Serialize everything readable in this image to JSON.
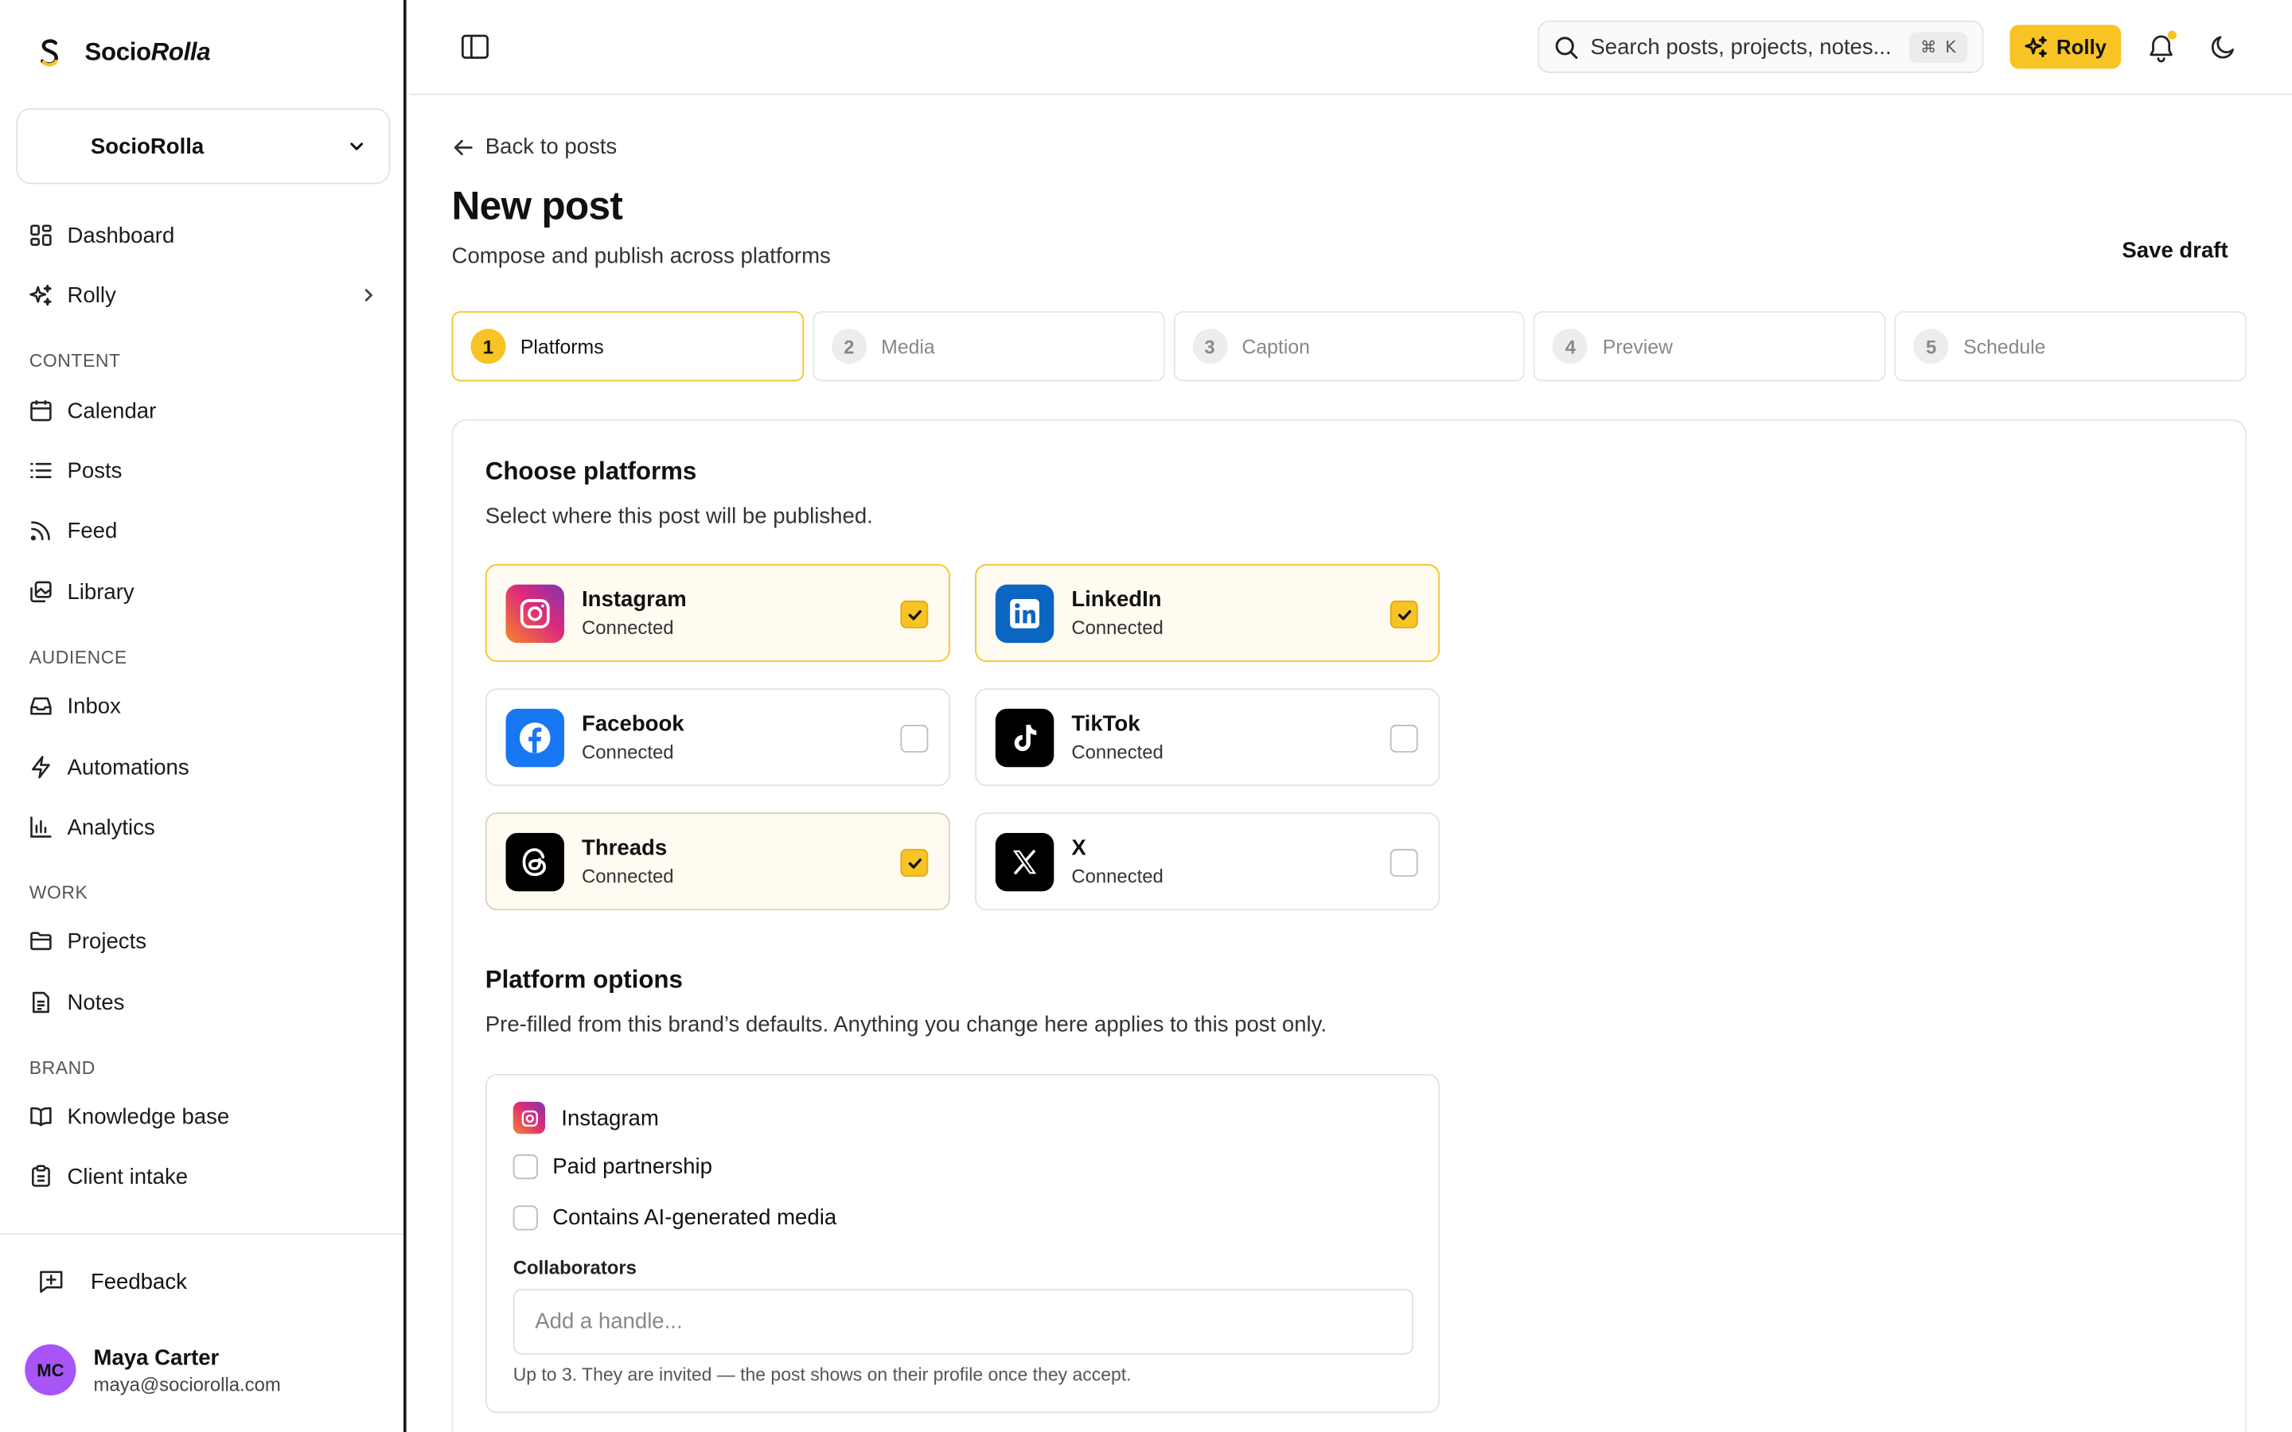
{
  "app": {
    "brand_prefix": "Socio",
    "brand_suffix": "Rolla"
  },
  "workspace": {
    "name": "SocioRolla"
  },
  "sidebar": {
    "top_items": [
      {
        "label": "Dashboard"
      },
      {
        "label": "Rolly"
      }
    ],
    "sections": [
      {
        "title": "CONTENT",
        "items": [
          {
            "label": "Calendar"
          },
          {
            "label": "Posts"
          },
          {
            "label": "Feed"
          },
          {
            "label": "Library"
          }
        ]
      },
      {
        "title": "AUDIENCE",
        "items": [
          {
            "label": "Inbox"
          },
          {
            "label": "Automations"
          },
          {
            "label": "Analytics"
          }
        ]
      },
      {
        "title": "WORK",
        "items": [
          {
            "label": "Projects"
          },
          {
            "label": "Notes"
          }
        ]
      },
      {
        "title": "BRAND",
        "items": [
          {
            "label": "Knowledge base"
          },
          {
            "label": "Client intake"
          }
        ]
      }
    ],
    "feedback_label": "Feedback",
    "user": {
      "initials": "MC",
      "name": "Maya Carter",
      "email": "maya@sociorolla.com"
    }
  },
  "topbar": {
    "search_placeholder": "Search posts, projects, notes...",
    "search_shortcut_symbol": "⌘",
    "search_shortcut_key": "K",
    "rolly_label": "Rolly"
  },
  "page": {
    "back_label": "Back to posts",
    "title": "New post",
    "subtitle": "Compose and publish across platforms",
    "save_draft_label": "Save draft"
  },
  "steps": [
    {
      "num": "1",
      "label": "Platforms",
      "active": true
    },
    {
      "num": "2",
      "label": "Media",
      "active": false
    },
    {
      "num": "3",
      "label": "Caption",
      "active": false
    },
    {
      "num": "4",
      "label": "Preview",
      "active": false
    },
    {
      "num": "5",
      "label": "Schedule",
      "active": false
    }
  ],
  "choose": {
    "title": "Choose platforms",
    "description": "Select where this post will be published.",
    "platforms": [
      {
        "name": "Instagram",
        "status": "Connected",
        "checked": true,
        "icon": "instagram-icon"
      },
      {
        "name": "LinkedIn",
        "status": "Connected",
        "checked": true,
        "icon": "linkedin-icon"
      },
      {
        "name": "Facebook",
        "status": "Connected",
        "checked": false,
        "icon": "facebook-icon"
      },
      {
        "name": "TikTok",
        "status": "Connected",
        "checked": false,
        "icon": "tiktok-icon"
      },
      {
        "name": "Threads",
        "status": "Connected",
        "checked": true,
        "icon": "threads-icon"
      },
      {
        "name": "X",
        "status": "Connected",
        "checked": false,
        "icon": "x-icon"
      }
    ]
  },
  "options": {
    "title": "Platform options",
    "description": "Pre-filled from this brand’s defaults. Anything you change here applies to this post only.",
    "platform_name": "Instagram",
    "paid_partnership_label": "Paid partnership",
    "paid_partnership_checked": false,
    "ai_media_label": "Contains AI-generated media",
    "ai_media_checked": false,
    "collaborators_label": "Collaborators",
    "collaborators_placeholder": "Add a handle...",
    "collaborators_value": "",
    "collaborators_help": "Up to 3. They are invited — the post shows on their profile once they accept."
  },
  "colors": {
    "accent": "#f7c325",
    "avatar": "#a855f7",
    "instagram_start": "#f58529",
    "instagram_end": "#c13584",
    "linkedin": "#0a66c2",
    "facebook": "#1877f2"
  }
}
